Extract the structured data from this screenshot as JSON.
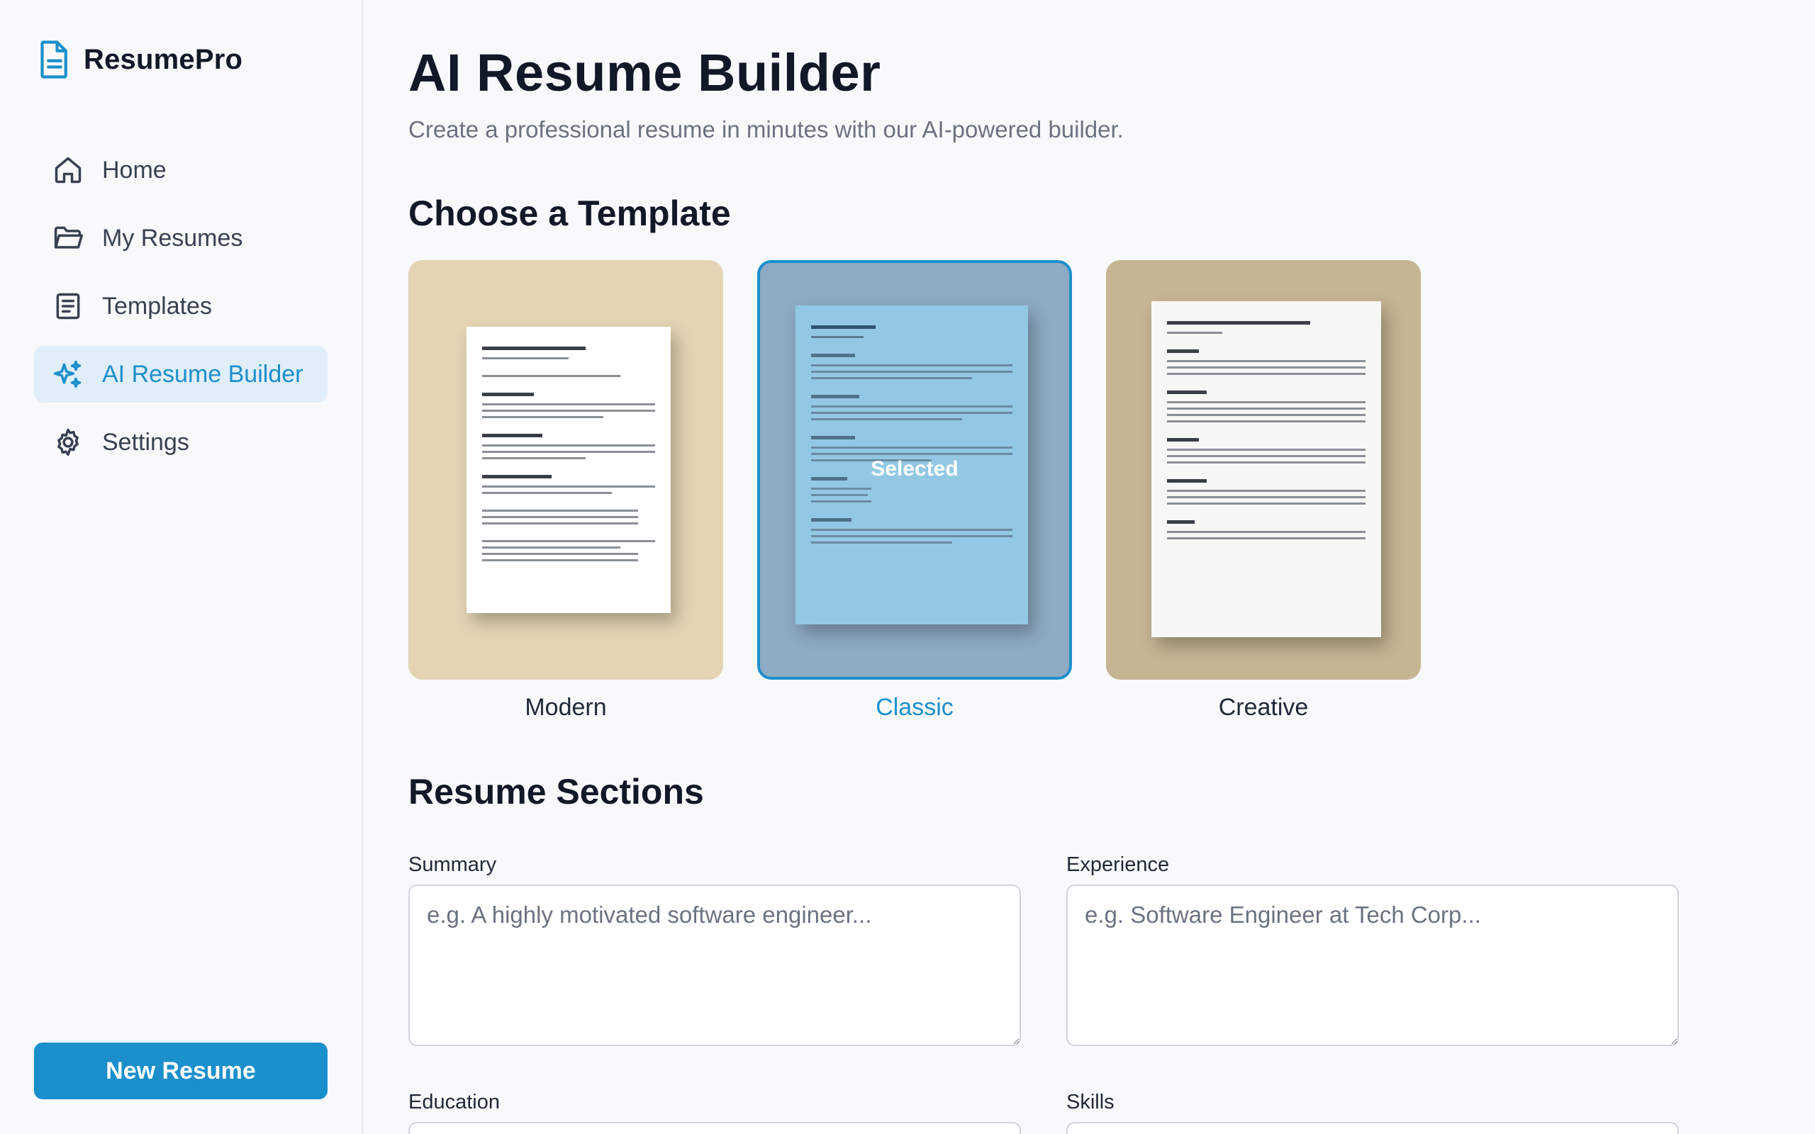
{
  "app": {
    "name": "ResumePro",
    "accent": "#1b8fcc"
  },
  "sidebar": {
    "items": [
      {
        "label": "Home",
        "icon": "home-icon"
      },
      {
        "label": "My Resumes",
        "icon": "folder-icon"
      },
      {
        "label": "Templates",
        "icon": "document-list-icon"
      },
      {
        "label": "AI Resume Builder",
        "icon": "sparkles-icon",
        "active": true
      },
      {
        "label": "Settings",
        "icon": "gear-icon"
      }
    ],
    "new_resume_label": "New Resume"
  },
  "main": {
    "title": "AI Resume Builder",
    "subtitle": "Create a professional resume in minutes with our AI-powered builder.",
    "templates_heading": "Choose a Template",
    "templates": [
      {
        "name": "Modern",
        "selected": false
      },
      {
        "name": "Classic",
        "selected": true,
        "badge": "Selected"
      },
      {
        "name": "Creative",
        "selected": false
      }
    ],
    "sections_heading": "Resume Sections",
    "fields": {
      "summary": {
        "label": "Summary",
        "placeholder": "e.g. A highly motivated software engineer...",
        "value": ""
      },
      "experience": {
        "label": "Experience",
        "placeholder": "e.g. Software Engineer at Tech Corp...",
        "value": ""
      },
      "education": {
        "label": "Education",
        "placeholder": "",
        "value": ""
      },
      "skills": {
        "label": "Skills",
        "placeholder": "",
        "value": ""
      }
    }
  }
}
